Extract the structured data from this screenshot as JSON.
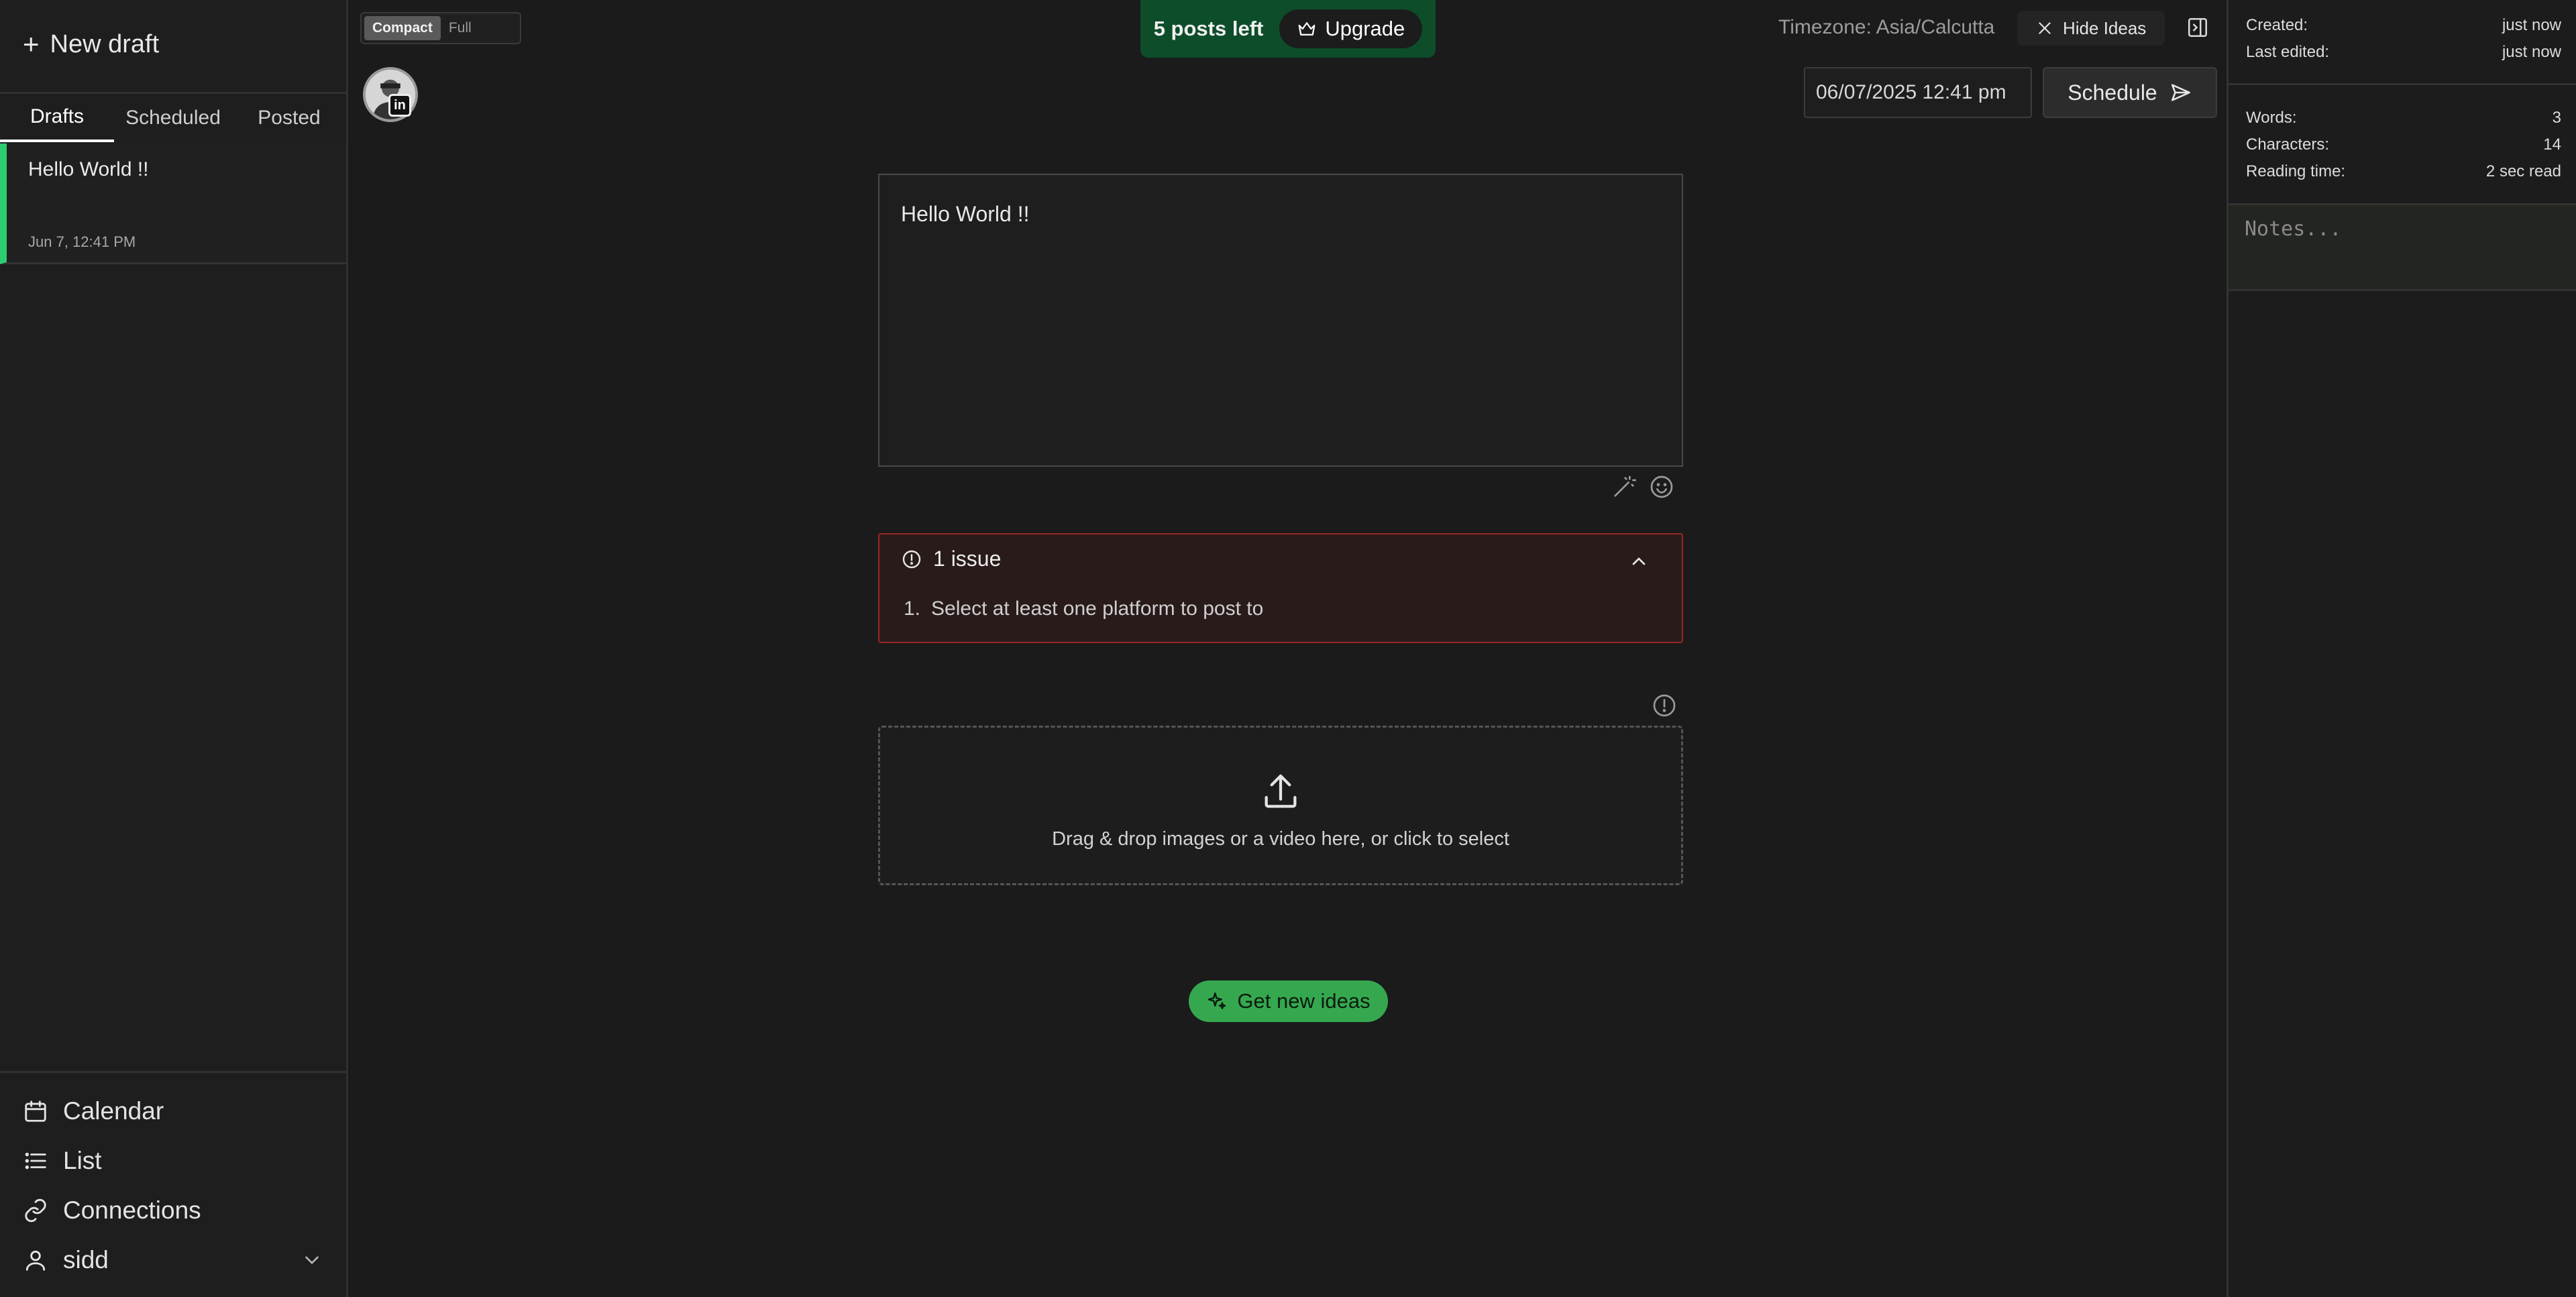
{
  "sidebar": {
    "new_draft_label": "New draft",
    "tabs": [
      {
        "label": "Drafts",
        "active": true
      },
      {
        "label": "Scheduled",
        "active": false
      },
      {
        "label": "Posted",
        "active": false
      }
    ],
    "drafts": [
      {
        "title": "Hello World !!",
        "date": "Jun 7, 12:41 PM"
      }
    ],
    "nav": [
      {
        "label": "Calendar",
        "icon": "calendar-icon"
      },
      {
        "label": "List",
        "icon": "list-icon"
      },
      {
        "label": "Connections",
        "icon": "link-icon"
      },
      {
        "label": "sidd",
        "icon": "user-icon"
      }
    ]
  },
  "toolbar": {
    "view_options": [
      "Compact",
      "Full"
    ],
    "active_view": "Compact",
    "account_badge": "in",
    "banner_text": "5 posts left",
    "upgrade_label": "Upgrade",
    "timezone": "Timezone: Asia/Calcutta",
    "hide_ideas_label": "Hide Ideas",
    "datetime_value": "06/07/2025 12:41 pm",
    "schedule_label": "Schedule"
  },
  "editor": {
    "content": "Hello World !!"
  },
  "issues": {
    "header": "1 issue",
    "items": [
      {
        "number": "1.",
        "text": "Select at least one platform to post to"
      }
    ]
  },
  "dropzone": {
    "text": "Drag & drop images or a video here, or click to select"
  },
  "ideas": {
    "button_label": "Get new ideas"
  },
  "stats": {
    "created_label": "Created:",
    "created_value": "just now",
    "edited_label": "Last edited:",
    "edited_value": "just now",
    "words_label": "Words:",
    "words_value": "3",
    "chars_label": "Characters:",
    "chars_value": "14",
    "reading_label": "Reading time:",
    "reading_value": "2 sec read",
    "notes_placeholder": "Notes..."
  },
  "colors": {
    "accent_green": "#35a84f",
    "draft_marker": "#2ecc71",
    "error_border": "#9a2626",
    "banner_bg": "#0d4d2a"
  }
}
